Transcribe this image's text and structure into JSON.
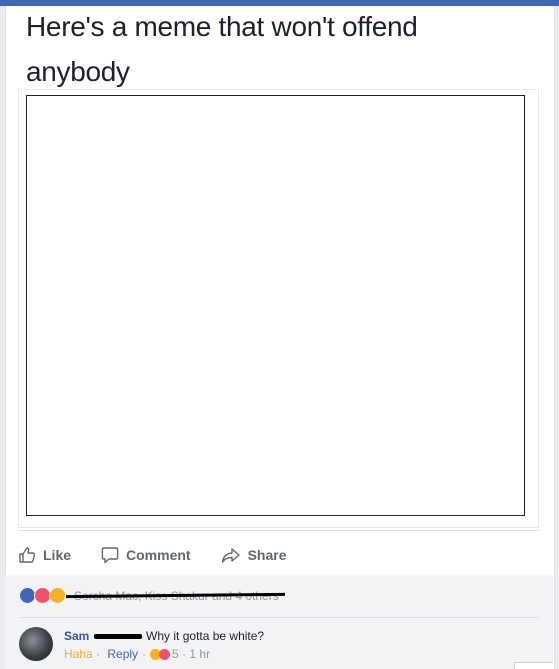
{
  "post": {
    "text": "Here's a meme that won't offend anybody"
  },
  "actions": {
    "like": "Like",
    "comment": "Comment",
    "share": "Share"
  },
  "reactions": {
    "icons": [
      "like",
      "love",
      "haha"
    ],
    "names": "Sorcha Mac, Kiss Shakur and 4 others"
  },
  "comment": {
    "author": "Sam",
    "text": "Why it gotta be white?",
    "reaction_label": "Haha",
    "reply_label": "Reply",
    "reaction_count": "5",
    "time": "1 hr"
  },
  "colors": {
    "brand": "#4267b2",
    "like": "#4267b2",
    "love": "#f25268",
    "haha": "#f7b125"
  }
}
